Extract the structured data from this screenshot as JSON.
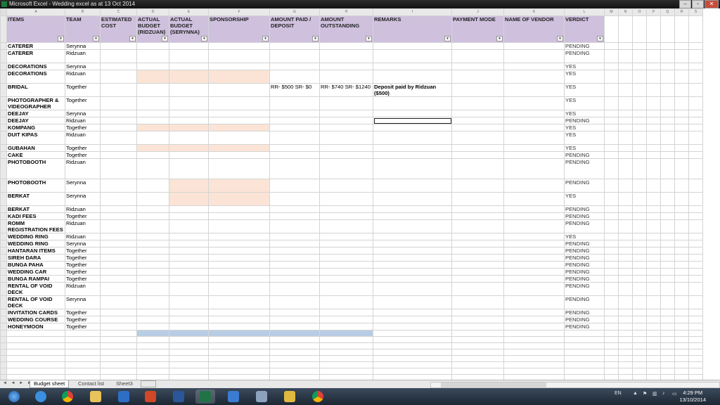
{
  "window": {
    "title": "Microsoft Excel - Wedding excel as at 13 Oct 2014",
    "buttons": {
      "minimize": "–",
      "restore": "▫",
      "close": "✕"
    }
  },
  "grid": {
    "column_letters": [
      "A",
      "B",
      "C",
      "D",
      "E",
      "F",
      "G",
      "H",
      "I",
      "J",
      "K",
      "L",
      "M",
      "N",
      "O",
      "P",
      "Q",
      "R",
      "S"
    ],
    "headers": [
      "ITEMS",
      "TEAM",
      "ESTIMATED COST",
      "ACTUAL BUDGET (RIDZUAN)",
      "ACTUAL BUDGET (SERYNNA)",
      "SPONSORSHIP",
      "AMOUNT PAID / DEPOSIT",
      "AMOUNT OUTSTANDING",
      "REMARKS",
      "PAYMENT MODE",
      "NAME OF VENDOR",
      "VERDICT"
    ],
    "dropdown_glyph": "▾",
    "rows": [
      {
        "item": "CATERER",
        "team": "Serynna",
        "verdict": "PENDING"
      },
      {
        "item": "CATERER",
        "team": "Ridzuan",
        "verdict": "PENDING"
      },
      {
        "item": "DECORATIONS",
        "team": "Serynna",
        "verdict": "YES"
      },
      {
        "item": "DECORATIONS",
        "team": "Ridzuan",
        "verdict": "YES"
      },
      {
        "item": "BRIDAL",
        "team": "Together",
        "paid": "RR- $500 SR- $0",
        "outstanding": "RR- $740 SR- $1240",
        "remarks": "Deposit paid by Ridzuan ($500)",
        "verdict": "YES"
      },
      {
        "item": "PHOTOGRAPHER & VIDEOGRAPHER",
        "team": "Together",
        "verdict": "YES"
      },
      {
        "item": "DEEJAY",
        "team": "Serynna",
        "verdict": "YES"
      },
      {
        "item": "DEEJAY",
        "team": "Ridzuan",
        "verdict": "PENDING"
      },
      {
        "item": "KOMPANG",
        "team": "Together",
        "verdict": "YES"
      },
      {
        "item": "DUIT KIPAS",
        "team": "Ridzuan",
        "verdict": "YES"
      },
      {
        "item": "GUBAHAN",
        "team": "Together",
        "verdict": "YES"
      },
      {
        "item": "CAKE",
        "team": "Together",
        "verdict": "PENDING"
      },
      {
        "item": "PHOTOBOOTH",
        "team": "Ridzuan",
        "verdict": "PENDING"
      },
      {
        "item": "PHOTOBOOTH",
        "team": "Serynna",
        "verdict": "PENDING"
      },
      {
        "item": "BERKAT",
        "team": "Serynna",
        "verdict": "YES"
      },
      {
        "item": "BERKAT",
        "team": "Ridzuan",
        "verdict": "PENDING"
      },
      {
        "item": "KADI FEES",
        "team": "Together",
        "verdict": "PENDING"
      },
      {
        "item": "ROMM REGISTRATION FEES",
        "team": "Ridzuan",
        "verdict": "PENDING"
      },
      {
        "item": "WEDDING RING",
        "team": "Ridzuan",
        "verdict": "YES"
      },
      {
        "item": "WEDDING RING",
        "team": "Serynna",
        "verdict": "PENDING"
      },
      {
        "item": "HANTARAN ITEMS",
        "team": "Together",
        "verdict": "PENDING"
      },
      {
        "item": "SIREH DARA",
        "team": "Together",
        "verdict": "PENDING"
      },
      {
        "item": "BUNGA PAHA",
        "team": "Together",
        "verdict": "PENDING"
      },
      {
        "item": "WEDDING CAR",
        "team": "Together",
        "verdict": "PENDING"
      },
      {
        "item": "BUNGA RAMPAI",
        "team": "Together",
        "verdict": "PENDING"
      },
      {
        "item": "RENTAL OF VOID DECK",
        "team": "Ridzuan",
        "verdict": "PENDING"
      },
      {
        "item": "RENTAL OF VOID DECK",
        "team": "Serynna",
        "verdict": "PENDING"
      },
      {
        "item": "INVITATION CARDS",
        "team": "Together",
        "verdict": "PENDING"
      },
      {
        "item": "WEDDING COURSE",
        "team": "Together",
        "verdict": "PENDING"
      },
      {
        "item": "HONEYMOON",
        "team": "Together",
        "verdict": "PENDING"
      }
    ]
  },
  "sheet_tabs": [
    "Budget sheet",
    "Contact list",
    "Sheet3"
  ],
  "nav_arrows": "◄ ◄ ► ►",
  "taskbar": {
    "language": "EN",
    "time": "4:29 PM",
    "date": "13/10/2014",
    "apps": [
      "start-orb",
      "internet-explorer",
      "chrome",
      "file-explorer",
      "outlook",
      "powerpoint",
      "word",
      "excel",
      "lync",
      "calculator",
      "folder",
      "chrome-2"
    ]
  },
  "colors": {
    "header_fill": "#cfc0de",
    "highlight_fill": "#fbe4d6",
    "total_fill": "#b8cce4"
  }
}
